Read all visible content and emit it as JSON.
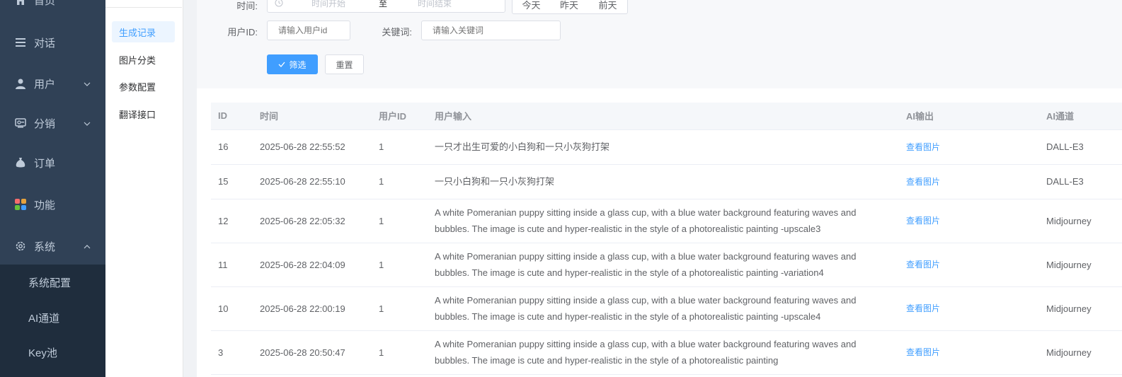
{
  "sidebar": {
    "items": [
      {
        "label": "首页",
        "icon": "home-icon"
      },
      {
        "label": "对话",
        "icon": "list-icon"
      },
      {
        "label": "用户",
        "icon": "user-icon"
      },
      {
        "label": "分销",
        "icon": "share-icon"
      },
      {
        "label": "订单",
        "icon": "money-bag-icon"
      },
      {
        "label": "功能",
        "icon": "grid-icon"
      },
      {
        "label": "系统",
        "icon": "gear-icon"
      }
    ],
    "system_submenu": [
      "系统配置",
      "AI通道",
      "Key池"
    ]
  },
  "submenu": {
    "items": [
      "生成记录",
      "图片分类",
      "参数配置",
      "翻译接口"
    ],
    "active": "生成记录"
  },
  "filter": {
    "time_label": "时间:",
    "time_start_placeholder": "时间开始",
    "time_separator": "至",
    "time_end_placeholder": "时间结束",
    "quick_ranges": [
      "今天",
      "昨天",
      "前天"
    ],
    "user_id_label": "用户ID:",
    "user_id_placeholder": "请输入用户id",
    "keyword_label": "关键词:",
    "keyword_placeholder": "请输入关键词",
    "filter_button": "筛选",
    "reset_button": "重置"
  },
  "table": {
    "columns": [
      "ID",
      "时间",
      "用户ID",
      "用户输入",
      "AI输出",
      "AI通道"
    ],
    "rows": [
      {
        "id": "16",
        "time": "2025-06-28 22:55:52",
        "user_id": "1",
        "input": "一只才出生可爱的小白狗和一只小灰狗打架",
        "output": "查看图片",
        "channel": "DALL-E3"
      },
      {
        "id": "15",
        "time": "2025-06-28 22:55:10",
        "user_id": "1",
        "input": "一只小白狗和一只小灰狗打架",
        "output": "查看图片",
        "channel": "DALL-E3"
      },
      {
        "id": "12",
        "time": "2025-06-28 22:05:32",
        "user_id": "1",
        "input": "A white Pomeranian puppy sitting inside a glass cup, with a blue water background featuring waves and bubbles. The image is cute and hyper-realistic in the style of a photorealistic painting  -upscale3",
        "output": "查看图片",
        "channel": "Midjourney"
      },
      {
        "id": "11",
        "time": "2025-06-28 22:04:09",
        "user_id": "1",
        "input": "A white Pomeranian puppy sitting inside a glass cup, with a blue water background featuring waves and bubbles. The image is cute and hyper-realistic in the style of a photorealistic painting -variation4",
        "output": "查看图片",
        "channel": "Midjourney"
      },
      {
        "id": "10",
        "time": "2025-06-28 22:00:19",
        "user_id": "1",
        "input": "A white Pomeranian puppy sitting inside a glass cup, with a blue water background featuring waves and bubbles. The image is cute and hyper-realistic in the style of a photorealistic painting -upscale4",
        "output": "查看图片",
        "channel": "Midjourney"
      },
      {
        "id": "3",
        "time": "2025-06-28 20:50:47",
        "user_id": "1",
        "input": "A white Pomeranian puppy sitting inside a glass cup, with a blue water background featuring waves and bubbles. The image is cute and hyper-realistic in the style of a photorealistic painting",
        "output": "查看图片",
        "channel": "Midjourney"
      }
    ]
  }
}
